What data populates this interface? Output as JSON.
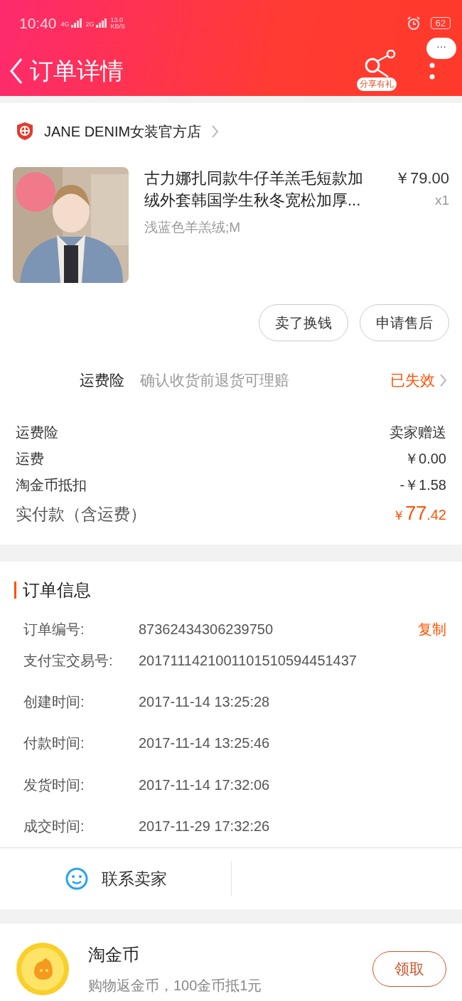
{
  "status_bar": {
    "time": "10:40",
    "network_1": "4G",
    "network_2": "2G",
    "speed": "13.0",
    "speed_unit": "KB/S",
    "battery": "62"
  },
  "nav": {
    "title": "订单详情",
    "share_label": "分享有礼",
    "bubble": "···"
  },
  "store": {
    "name": "JANE DENIM女装官方店"
  },
  "product": {
    "kind": "picture",
    "title": "古力娜扎同款牛仔羊羔毛短款加绒外套韩国学生秋冬宽松加厚...",
    "sku": "浅蓝色羊羔绒;M",
    "price": "￥79.00",
    "quantity": "x1"
  },
  "actions": [
    "卖了换钱",
    "申请售后"
  ],
  "insurance": {
    "label": "运费险",
    "description": "确认收货前退货可理赔",
    "status": "已失效"
  },
  "fees": [
    {
      "label": "运费险",
      "value": "卖家赠送"
    },
    {
      "label": "运费",
      "value": "￥0.00"
    },
    {
      "label": "淘金币抵扣",
      "value": "-￥1.58"
    }
  ],
  "total": {
    "label": "实付款（含运费）",
    "currency": "￥",
    "integer": "77",
    "decimal": ".42"
  },
  "order_info": {
    "title": "订单信息",
    "rows": [
      {
        "label": "订单编号:",
        "value": "87362434306239750",
        "action": "复制"
      },
      {
        "label": "支付宝交易号:",
        "value": "2017111421001101510594451437"
      },
      {
        "label": "创建时间:",
        "value": "2017-11-14 13:25:28"
      },
      {
        "label": "付款时间:",
        "value": "2017-11-14 13:25:46"
      },
      {
        "label": "发货时间:",
        "value": "2017-11-14 17:32:06"
      },
      {
        "label": "成交时间:",
        "value": "2017-11-29 17:32:26"
      }
    ]
  },
  "contact": {
    "label": "联系卖家"
  },
  "coins": {
    "title": "淘金币",
    "description": "购物返金币，100金币抵1元",
    "button": "领取"
  }
}
